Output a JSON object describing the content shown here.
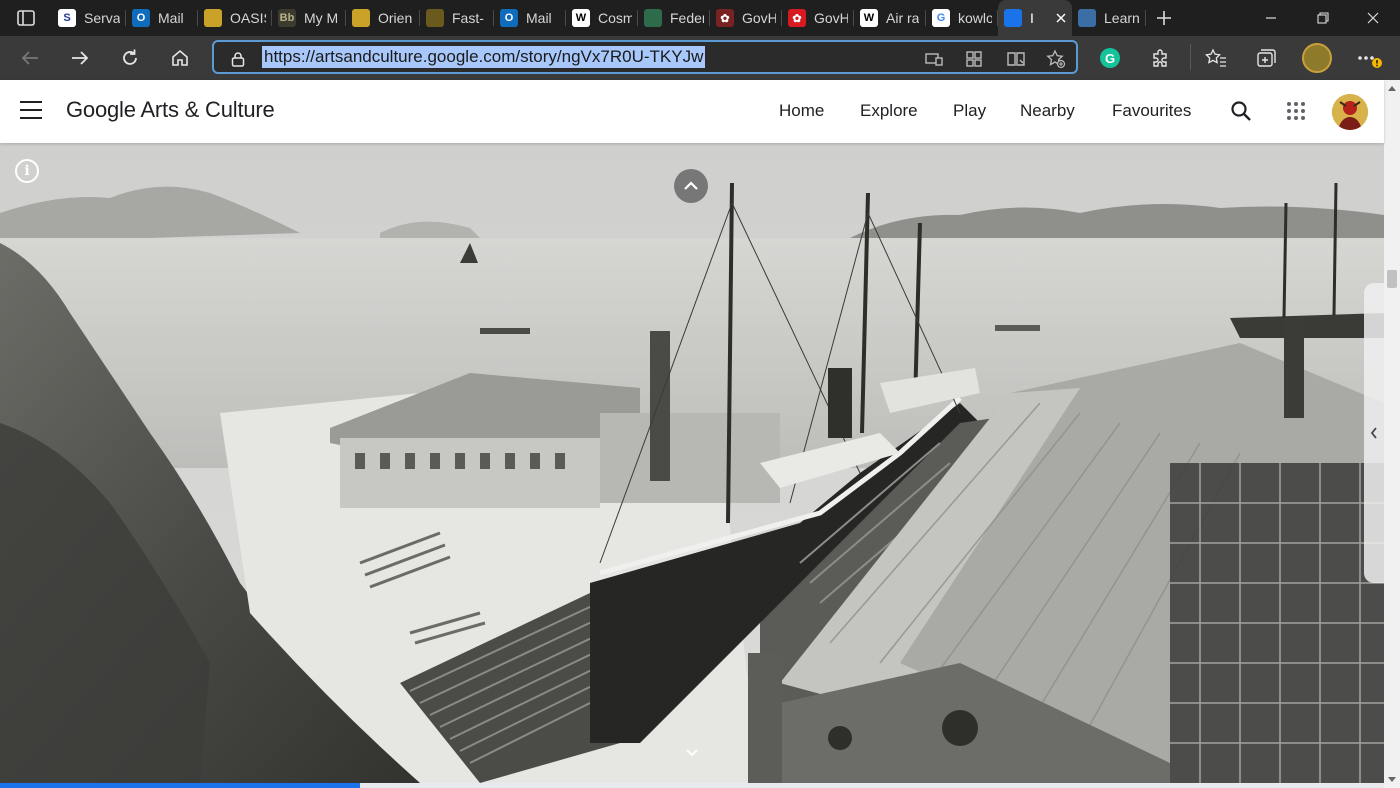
{
  "browser": {
    "tabs": [
      {
        "title": "Serva",
        "icon": "s-icon",
        "color": "#ffffff",
        "text": "S",
        "fg": "#1f3a93"
      },
      {
        "title": "Mail",
        "icon": "outlook-icon",
        "color": "#0f6cbd",
        "text": "O",
        "fg": "#ffffff"
      },
      {
        "title": "OASIS",
        "icon": "shield-icon",
        "color": "#c9a227",
        "text": "",
        "fg": "#ffffff"
      },
      {
        "title": "My M",
        "icon": "blackboard-icon",
        "color": "#3b3b30",
        "text": "Bb",
        "fg": "#b9b08a"
      },
      {
        "title": "Orien",
        "icon": "shield-icon",
        "color": "#c9a227",
        "text": "",
        "fg": "#ffffff"
      },
      {
        "title": "Fast-",
        "icon": "shield-icon",
        "color": "#6b5a1e",
        "text": "",
        "fg": "#ffffff"
      },
      {
        "title": "Mail",
        "icon": "outlook-icon",
        "color": "#0f6cbd",
        "text": "O",
        "fg": "#ffffff"
      },
      {
        "title": "Cosm",
        "icon": "wikipedia-icon",
        "color": "#ffffff",
        "text": "W",
        "fg": "#000000"
      },
      {
        "title": "Feder",
        "icon": "globe-icon",
        "color": "#2e6b4a",
        "text": "",
        "fg": "#ffffff"
      },
      {
        "title": "GovH",
        "icon": "bauhinia-icon",
        "color": "#7a2222",
        "text": "✿",
        "fg": "#ffffff"
      },
      {
        "title": "GovH",
        "icon": "bauhinia-icon",
        "color": "#d71920",
        "text": "✿",
        "fg": "#ffffff"
      },
      {
        "title": "Air ra",
        "icon": "wikipedia-icon",
        "color": "#ffffff",
        "text": "W",
        "fg": "#000000"
      },
      {
        "title": "kowlo",
        "icon": "google-icon",
        "color": "#ffffff",
        "text": "G",
        "fg": "#4285f4"
      },
      {
        "title": "I",
        "icon": "arts-culture-icon",
        "color": "#1a73e8",
        "text": "",
        "fg": "#ffffff",
        "active": true
      },
      {
        "title": "Learn",
        "icon": "learn-icon",
        "color": "#3a6ea5",
        "text": "",
        "fg": "#ffffff"
      }
    ],
    "url": "https://artsandculture.google.com/story/ngVx7R0U-TKYJw"
  },
  "header": {
    "brand": "Google Arts & Culture",
    "nav": [
      "Home",
      "Explore",
      "Play",
      "Nearby",
      "Favourites"
    ]
  },
  "story": {
    "progress_fraction": 0.26
  },
  "colors": {
    "accent": "#1a73e8",
    "tabstrip_bg": "#1f1f1f",
    "toolbar_bg": "#3a3a3a",
    "url_highlight": "#a8c7fa"
  }
}
